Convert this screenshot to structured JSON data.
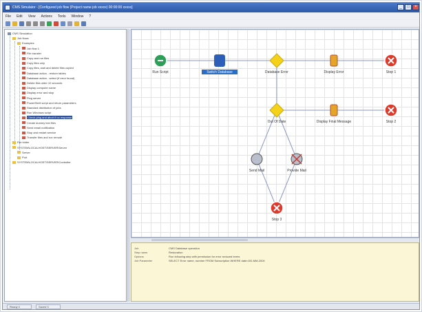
{
  "window": {
    "title": "CMS Simulator - [Configured job flow (Project name job xxxxx) 00:00:00 xxxxx]",
    "buttons": {
      "minimize": "_",
      "maximize": "□",
      "close": "×"
    }
  },
  "menu": [
    "File",
    "Edit",
    "View",
    "Actions",
    "Tools",
    "Window",
    "?"
  ],
  "toolbar": {
    "buttons": [
      "new-icon",
      "open-icon",
      "save-icon",
      "cut-icon",
      "copy-icon",
      "paste-icon",
      "run-icon",
      "stop-icon",
      "zoom-icon",
      "grid-icon",
      "props-icon",
      "help-icon"
    ]
  },
  "sidebar": {
    "items": [
      {
        "label": "CMS Simulation",
        "level": 0
      },
      {
        "label": "Job flows",
        "level": 1
      },
      {
        "label": "Examples",
        "level": 2
      },
      {
        "label": "Job flow 1",
        "level": 3
      },
      {
        "label": "File transfer",
        "level": 3
      },
      {
        "label": "Copy and run files",
        "level": 3
      },
      {
        "label": "Copy files only",
        "level": 3
      },
      {
        "label": "Copy files, wait and delete files copied",
        "level": 3
      },
      {
        "label": "Database action - restore tables",
        "level": 3
      },
      {
        "label": "Database action - select (if error found)",
        "level": 3
      },
      {
        "label": "Delete files older 10 seconds",
        "level": 3
      },
      {
        "label": "Display computer name",
        "level": 3
      },
      {
        "label": "Display error and stop",
        "level": 3
      },
      {
        "label": "Ping server",
        "level": 3
      },
      {
        "label": "PowerShell script and return parameters",
        "level": 3
      },
      {
        "label": "Standard distribution of jobs",
        "level": 3
      },
      {
        "label": "Run Windows script",
        "level": 3
      },
      {
        "label": "Check ping and abort if no response",
        "level": 3
      },
      {
        "label": "Create dummy text files",
        "level": 3
      },
      {
        "label": "Send email notification",
        "level": 3
      },
      {
        "label": "Stop and restart service",
        "level": 3
      },
      {
        "label": "Transfer files and run remote",
        "level": 3
      },
      {
        "label": "File folder",
        "level": 1
      },
      {
        "label": "SYSTEM\\LOCALHOST\\SERVER\\Server",
        "level": 1
      },
      {
        "label": "Server",
        "level": 2
      },
      {
        "label": "Port",
        "level": 2
      },
      {
        "label": "SYSTEM\\LOCALHOST\\SERVER\\Controller",
        "level": 1
      }
    ],
    "selected_index": 17
  },
  "flow": {
    "nodes": [
      {
        "label": "Run Script",
        "type": "start"
      },
      {
        "label": "Switch Database",
        "type": "task",
        "selected": true
      },
      {
        "label": "Database Error",
        "type": "decision"
      },
      {
        "label": "Display Error",
        "type": "message"
      },
      {
        "label": "Stop 1",
        "type": "stop"
      },
      {
        "label": "Out Of Date",
        "type": "decision"
      },
      {
        "label": "Display Final Message",
        "type": "message"
      },
      {
        "label": "Stop 2",
        "type": "stop"
      },
      {
        "label": "Send Mail",
        "type": "mail"
      },
      {
        "label": "Provide Mail",
        "type": "mail-alt"
      },
      {
        "label": "Stop 3",
        "type": "stop"
      }
    ]
  },
  "properties": [
    {
      "key": "Job",
      "value": "CMS Database operation"
    },
    {
      "key": "Step name",
      "value": "Restoration"
    },
    {
      "key": "Options",
      "value": "Run following step with permission for error reduced terms"
    },
    {
      "key": "Job Parameter",
      "value": "SELECT Error name, number FROM Subscription WHERE date=DD-MM-2004"
    }
  ],
  "status": {
    "panel1": "Ready 0",
    "panel2": "Saved 0"
  },
  "colors": {
    "start": "#2f9e58",
    "task": "#2d5fb8",
    "decision": "#f4d21b",
    "stop": "#dc3c2e",
    "message": "#e5a52a"
  }
}
